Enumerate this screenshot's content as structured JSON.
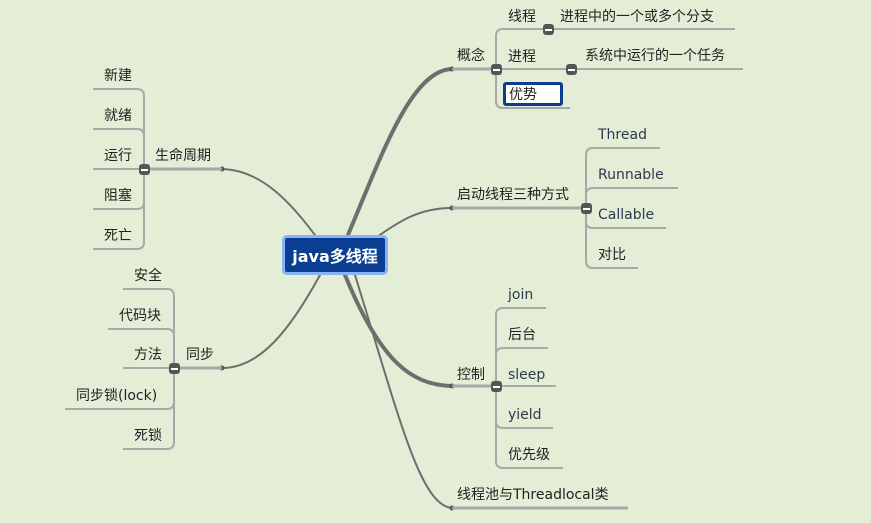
{
  "root": {
    "label": "java多线程"
  },
  "right": {
    "concept": {
      "label": "概念",
      "children": [
        {
          "label": "线程",
          "detail": "进程中的一个或多个分支"
        },
        {
          "label": "进程",
          "detail": "系统中运行的一个任务"
        },
        {
          "label": "优势",
          "selected": true
        }
      ]
    },
    "startup": {
      "label": "启动线程三种方式",
      "children": [
        "Thread",
        "Runnable",
        "Callable",
        "对比"
      ]
    },
    "control": {
      "label": "控制",
      "children": [
        "join",
        "后台",
        "sleep",
        "yield",
        "优先级"
      ]
    },
    "pool": {
      "label": "线程池与Threadlocal类"
    }
  },
  "left": {
    "lifecycle": {
      "label": "生命周期",
      "children": [
        "新建",
        "就绪",
        "运行",
        "阻塞",
        "死亡"
      ]
    },
    "sync": {
      "label": "同步",
      "children": [
        "安全",
        "代码块",
        "方法",
        "同步锁(lock)",
        "死锁"
      ]
    }
  },
  "colors": {
    "root_fill": "#0a3e92",
    "root_border": "#8ab3f3",
    "line": "#7a7a7a",
    "underline": "#aaaaaa",
    "grid": "#e4edd6"
  }
}
